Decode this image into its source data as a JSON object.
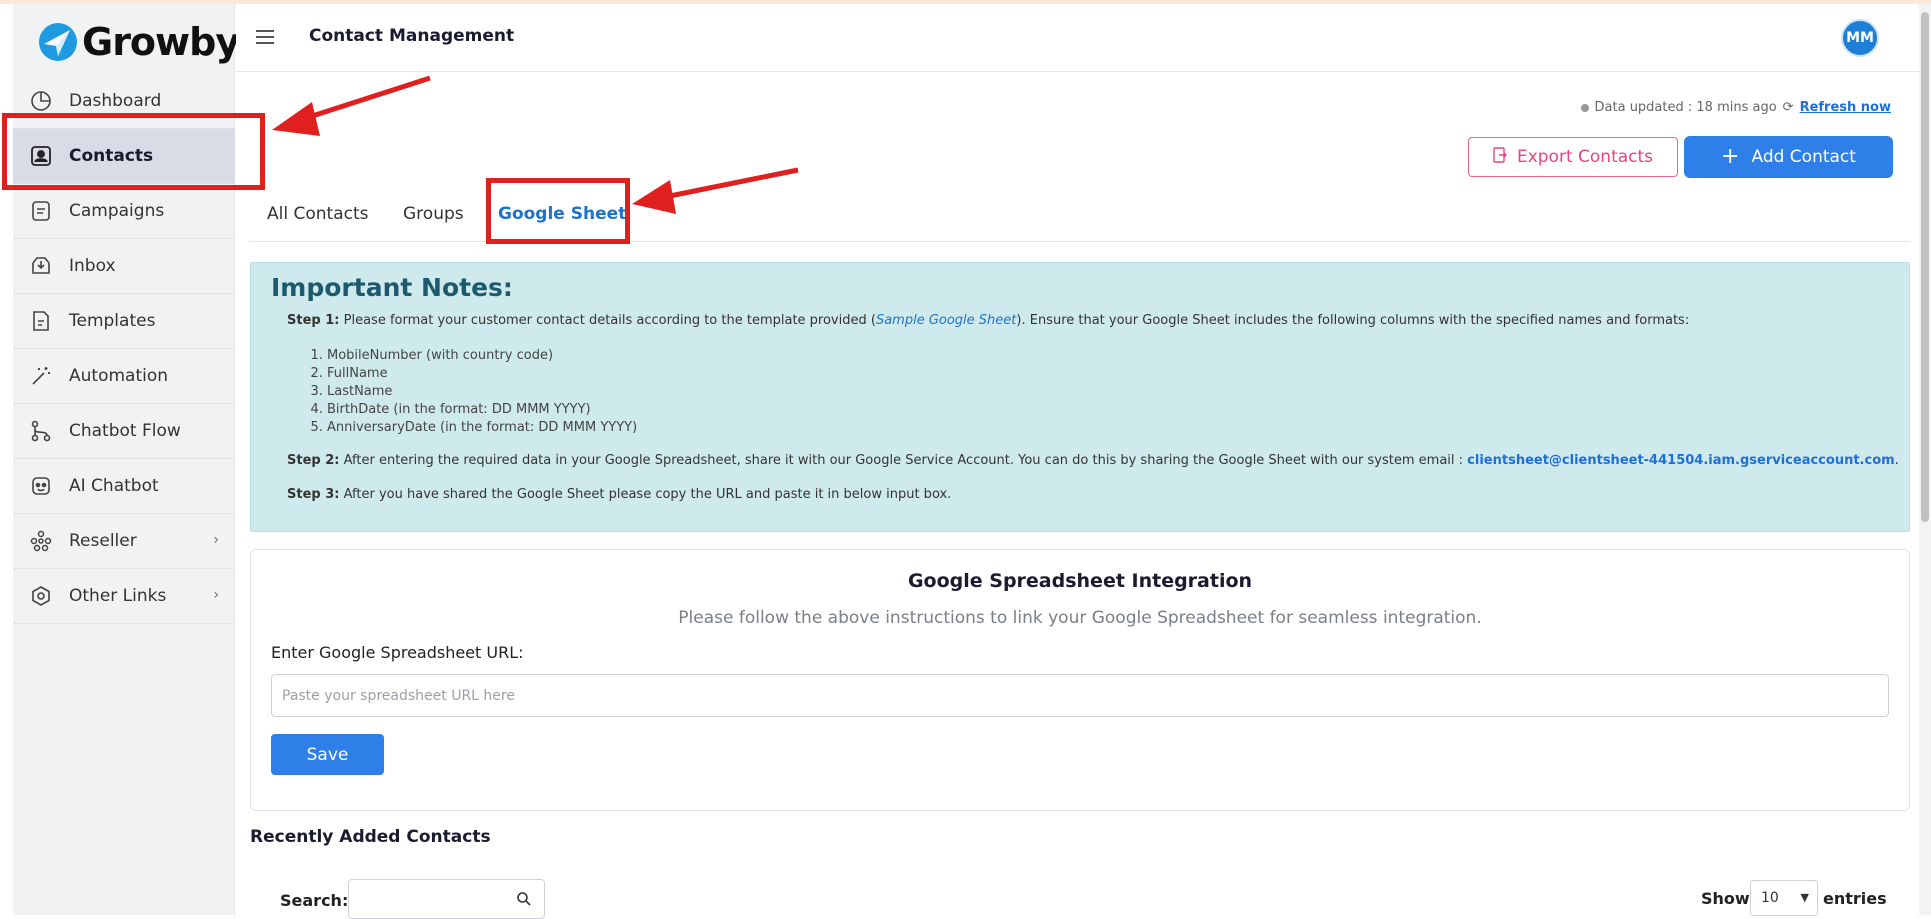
{
  "app": {
    "logo_text": "Growby",
    "brand_color": "#1e7fd6"
  },
  "header": {
    "title": "Contact Management",
    "avatar_initials": "MM"
  },
  "sidebar": {
    "items": [
      {
        "label": "Dashboard",
        "icon": "pie-chart-icon"
      },
      {
        "label": "Contacts",
        "icon": "contact-card-icon",
        "active": true
      },
      {
        "label": "Campaigns",
        "icon": "document-icon"
      },
      {
        "label": "Inbox",
        "icon": "inbox-icon"
      },
      {
        "label": "Templates",
        "icon": "template-icon"
      },
      {
        "label": "Automation",
        "icon": "magic-wand-icon"
      },
      {
        "label": "Chatbot Flow",
        "icon": "flow-icon"
      },
      {
        "label": "AI Chatbot",
        "icon": "robot-icon"
      },
      {
        "label": "Reseller",
        "icon": "network-icon",
        "has_submenu": true
      },
      {
        "label": "Other Links",
        "icon": "hexagon-icon",
        "has_submenu": true
      }
    ]
  },
  "status": {
    "text": "Data updated : 18 mins ago",
    "refresh_label": "Refresh now"
  },
  "actions": {
    "export_label": "Export Contacts",
    "add_label": "Add Contact"
  },
  "tabs": [
    {
      "label": "All Contacts"
    },
    {
      "label": "Groups"
    },
    {
      "label": "Google Sheet",
      "active": true
    }
  ],
  "notes": {
    "title": "Important Notes:",
    "step1_label": "Step 1:",
    "step1_text_a": "Please format your customer contact details according to the template provided (",
    "step1_link": "Sample Google Sheet",
    "step1_text_b": "). Ensure that your Google Sheet includes the following columns with the specified names and formats:",
    "columns": [
      "MobileNumber (with country code)",
      "FullName",
      "LastName",
      "BirthDate (in the format: DD MMM YYYY)",
      "AnniversaryDate (in the format: DD MMM YYYY)"
    ],
    "step2_label": "Step 2:",
    "step2_text": "After entering the required data in your Google Spreadsheet, share it with our Google Service Account. You can do this by sharing the Google Sheet with our system email :",
    "step2_email": "clientsheet@clientsheet-441504.iam.gserviceaccount.com",
    "step2_end": ".",
    "step3_label": "Step 3:",
    "step3_text": "After you have shared the Google Sheet please copy the URL and paste it in below input box."
  },
  "integration": {
    "title": "Google Spreadsheet Integration",
    "subtitle": "Please follow the above instructions to link your Google Spreadsheet for seamless integration.",
    "url_label": "Enter Google Spreadsheet URL:",
    "url_placeholder": "Paste your spreadsheet URL here",
    "url_value": "",
    "save_label": "Save"
  },
  "recent": {
    "title": "Recently Added Contacts",
    "search_label": "Search:",
    "show_label": "Show",
    "page_size": "10",
    "entries_label": "entries"
  },
  "colors": {
    "primary": "#2f7fe8",
    "export": "#e8457a",
    "notes_bg": "#cfeaec",
    "annotation": "#e01f1f"
  }
}
